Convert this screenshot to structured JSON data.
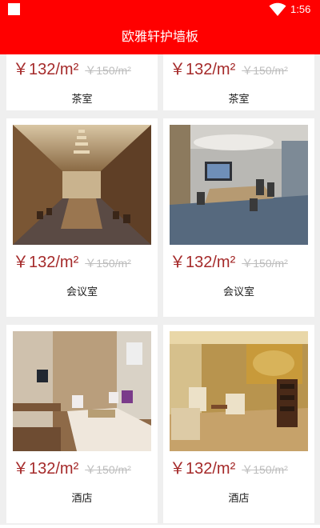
{
  "status_bar": {
    "time": "1:56"
  },
  "app_bar": {
    "title": "欧雅轩护墙板"
  },
  "products": [
    {
      "label": "茶室",
      "price": "￥132/m²",
      "old_price": "￥150/m²"
    },
    {
      "label": "茶室",
      "price": "￥132/m²",
      "old_price": "￥150/m²"
    },
    {
      "label": "会议室",
      "price": "￥132/m²",
      "old_price": "￥150/m²"
    },
    {
      "label": "会议室",
      "price": "￥132/m²",
      "old_price": "￥150/m²"
    },
    {
      "label": "酒店",
      "price": "￥132/m²",
      "old_price": "￥150/m²"
    },
    {
      "label": "酒店",
      "price": "￥132/m²",
      "old_price": "￥150/m²"
    }
  ]
}
